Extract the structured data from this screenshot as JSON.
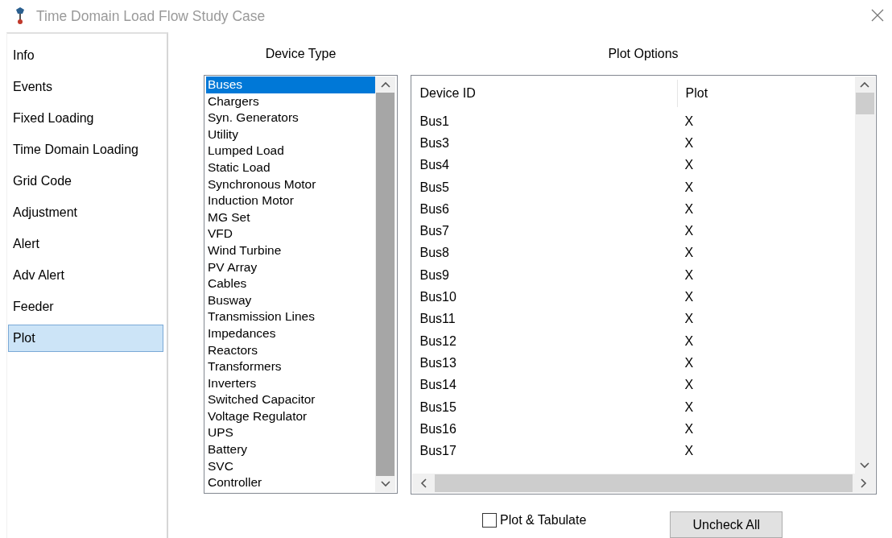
{
  "window": {
    "title": "Time Domain Load Flow Study Case"
  },
  "sidebar": {
    "items": [
      {
        "label": "Info",
        "selected": false
      },
      {
        "label": "Events",
        "selected": false
      },
      {
        "label": "Fixed Loading",
        "selected": false
      },
      {
        "label": "Time Domain Loading",
        "selected": false
      },
      {
        "label": "Grid Code",
        "selected": false
      },
      {
        "label": "Adjustment",
        "selected": false
      },
      {
        "label": "Alert",
        "selected": false
      },
      {
        "label": "Adv Alert",
        "selected": false
      },
      {
        "label": "Feeder",
        "selected": false
      },
      {
        "label": "Plot",
        "selected": true
      }
    ]
  },
  "device_type": {
    "label": "Device Type",
    "items": [
      {
        "label": "Buses",
        "selected": true
      },
      {
        "label": "Chargers",
        "selected": false
      },
      {
        "label": "Syn. Generators",
        "selected": false
      },
      {
        "label": "Utility",
        "selected": false
      },
      {
        "label": "Lumped Load",
        "selected": false
      },
      {
        "label": "Static Load",
        "selected": false
      },
      {
        "label": "Synchronous Motor",
        "selected": false
      },
      {
        "label": "Induction Motor",
        "selected": false
      },
      {
        "label": "MG Set",
        "selected": false
      },
      {
        "label": "VFD",
        "selected": false
      },
      {
        "label": "Wind Turbine",
        "selected": false
      },
      {
        "label": "PV Array",
        "selected": false
      },
      {
        "label": "Cables",
        "selected": false
      },
      {
        "label": "Busway",
        "selected": false
      },
      {
        "label": "Transmission Lines",
        "selected": false
      },
      {
        "label": "Impedances",
        "selected": false
      },
      {
        "label": "Reactors",
        "selected": false
      },
      {
        "label": "Transformers",
        "selected": false
      },
      {
        "label": "Inverters",
        "selected": false
      },
      {
        "label": "Switched Capacitor",
        "selected": false
      },
      {
        "label": "Voltage Regulator",
        "selected": false
      },
      {
        "label": "UPS",
        "selected": false
      },
      {
        "label": "Battery",
        "selected": false
      },
      {
        "label": "SVC",
        "selected": false
      },
      {
        "label": "Controller",
        "selected": false
      }
    ]
  },
  "plot_options": {
    "label": "Plot Options",
    "columns": [
      "Device ID",
      "Plot"
    ],
    "rows": [
      {
        "device_id": "Bus1",
        "plot": "X"
      },
      {
        "device_id": "Bus3",
        "plot": "X"
      },
      {
        "device_id": "Bus4",
        "plot": "X"
      },
      {
        "device_id": "Bus5",
        "plot": "X"
      },
      {
        "device_id": "Bus6",
        "plot": "X"
      },
      {
        "device_id": "Bus7",
        "plot": "X"
      },
      {
        "device_id": "Bus8",
        "plot": "X"
      },
      {
        "device_id": "Bus9",
        "plot": "X"
      },
      {
        "device_id": "Bus10",
        "plot": "X"
      },
      {
        "device_id": "Bus11",
        "plot": "X"
      },
      {
        "device_id": "Bus12",
        "plot": "X"
      },
      {
        "device_id": "Bus13",
        "plot": "X"
      },
      {
        "device_id": "Bus14",
        "plot": "X"
      },
      {
        "device_id": "Bus15",
        "plot": "X"
      },
      {
        "device_id": "Bus16",
        "plot": "X"
      },
      {
        "device_id": "Bus17",
        "plot": "X"
      }
    ]
  },
  "plot_tabulate": {
    "label": "Plot & Tabulate",
    "checked": false
  },
  "uncheck_all_button": {
    "label": "Uncheck All"
  }
}
